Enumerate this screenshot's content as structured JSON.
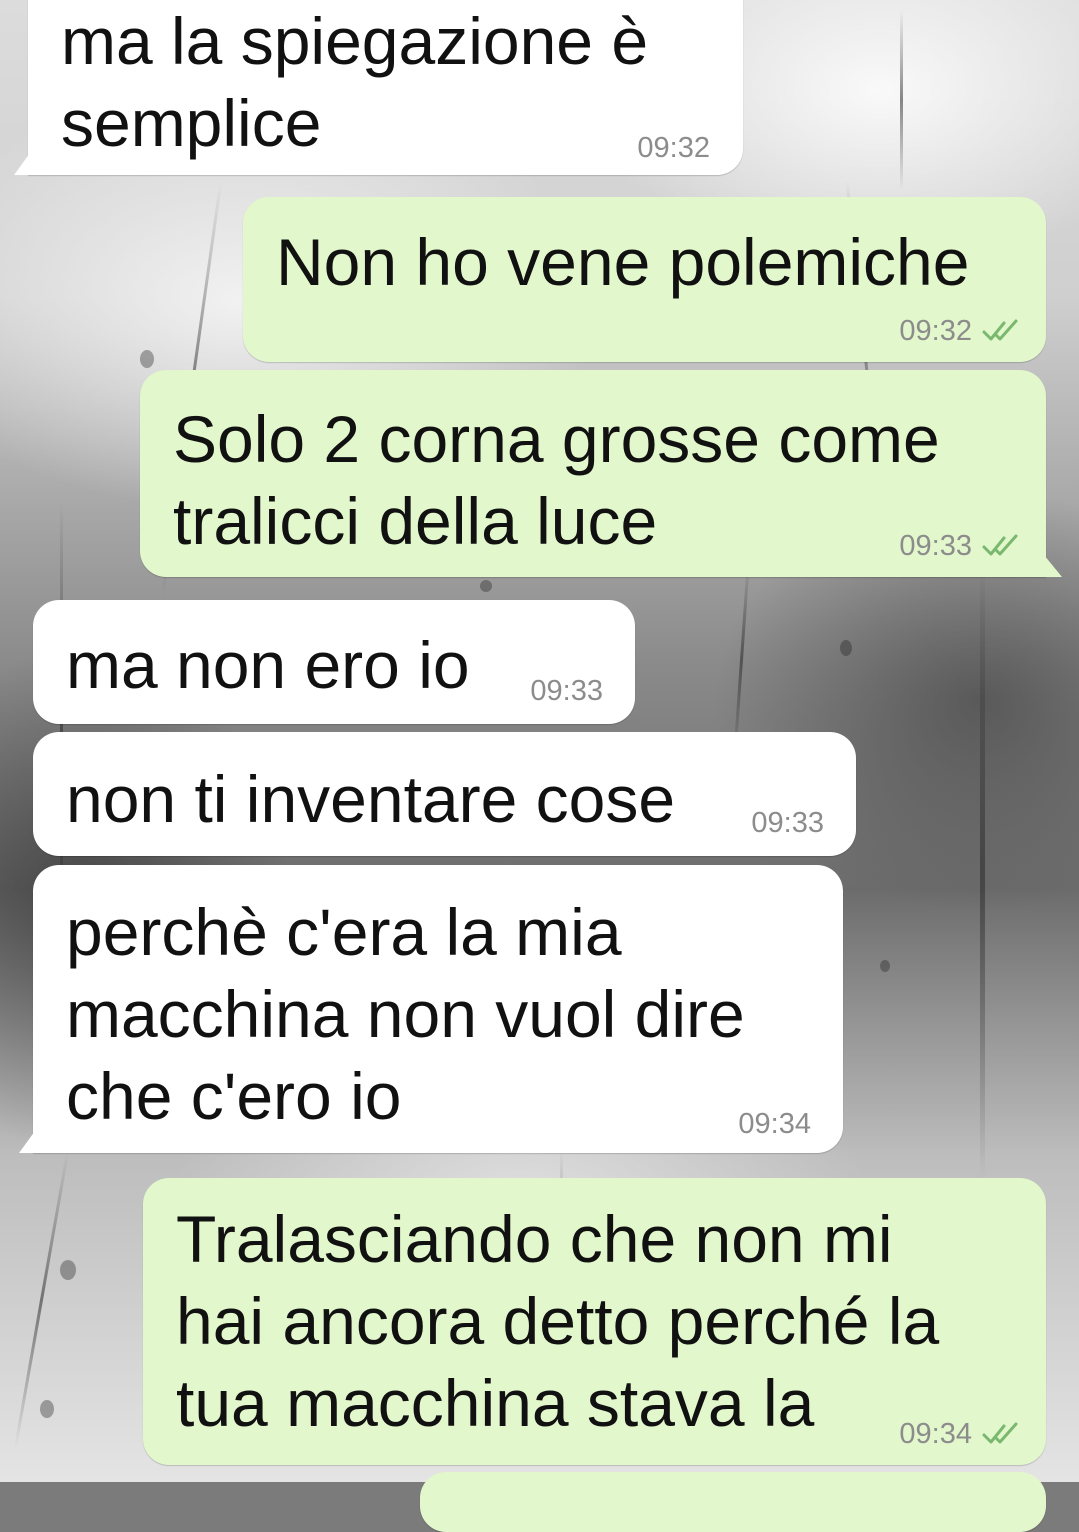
{
  "conversation": {
    "messages": [
      {
        "direction": "incoming",
        "text": "ma la spiegazione è\nsemplice",
        "time": "09:32"
      },
      {
        "direction": "outgoing",
        "text": "Non ho vene polemiche",
        "time": "09:32",
        "status": "read"
      },
      {
        "direction": "outgoing",
        "text": "Solo 2 corna grosse come\ntralicci della luce",
        "time": "09:33",
        "status": "read"
      },
      {
        "direction": "incoming",
        "text": "ma non ero io",
        "time": "09:33"
      },
      {
        "direction": "incoming",
        "text": "non ti inventare cose",
        "time": "09:33"
      },
      {
        "direction": "incoming",
        "text": "perchè c'era la mia\nmacchina non vuol dire\nche c'ero io",
        "time": "09:34"
      },
      {
        "direction": "outgoing",
        "text": "Tralasciando che non mi\nhai ancora detto perché la\ntua macchina stava la",
        "time": "09:34",
        "status": "read"
      }
    ]
  },
  "icons": {
    "read_receipt": "double-check-icon"
  },
  "colors": {
    "incoming_bubble": "#ffffff",
    "outgoing_bubble": "#e2f7cb",
    "timestamp": "#8c8c8c",
    "read_tick": "#4fc3f7"
  }
}
